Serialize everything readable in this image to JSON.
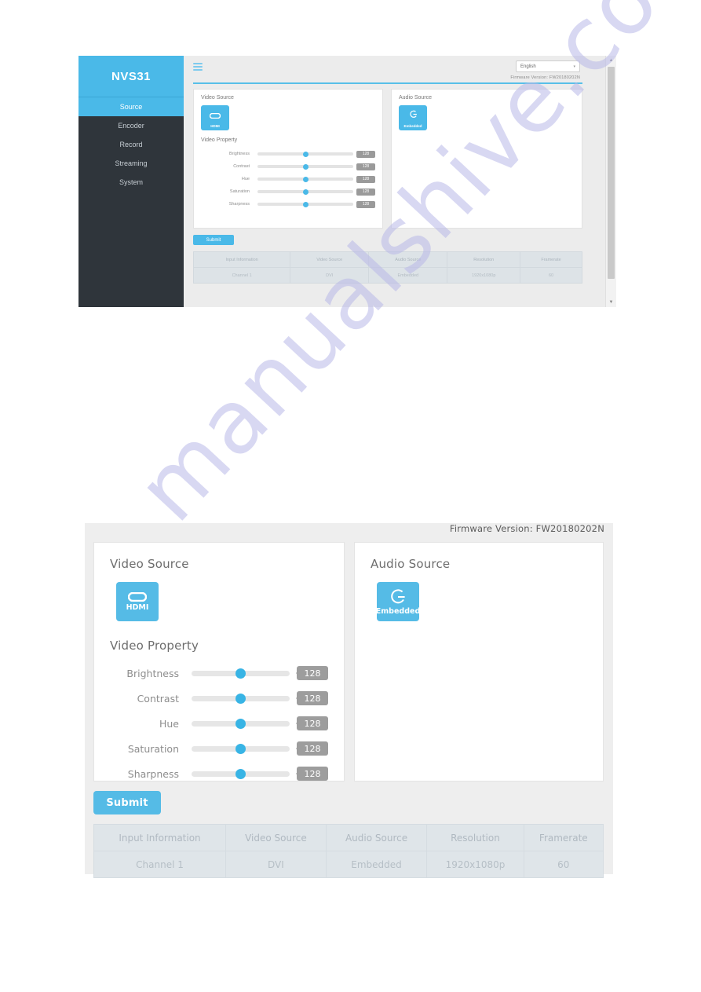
{
  "watermark": {
    "text": "manualshive.com"
  },
  "screenshot_top": {
    "logo": "NVS31",
    "sidebar_items": [
      {
        "label": "Source",
        "active": true
      },
      {
        "label": "Encoder",
        "active": false
      },
      {
        "label": "Record",
        "active": false
      },
      {
        "label": "Streaming",
        "active": false
      },
      {
        "label": "System",
        "active": false
      }
    ],
    "language_select": {
      "value": "English",
      "caret": "▾"
    },
    "firmware": "Firmware Version: FW20180202N",
    "menu_icon": "hamburger-menu-icon",
    "video_source": {
      "heading": "Video Source",
      "tile_label": "HDMI",
      "tile_icon": "hdmi-port-icon"
    },
    "audio_source": {
      "heading": "Audio Source",
      "tile_label": "Embedded",
      "tile_icon": "embedded-audio-icon"
    },
    "video_property": {
      "heading": "Video Property",
      "sliders": [
        {
          "label": "Brightness",
          "value": "128"
        },
        {
          "label": "Contrast",
          "value": "128"
        },
        {
          "label": "Hue",
          "value": "128"
        },
        {
          "label": "Saturation",
          "value": "128"
        },
        {
          "label": "Sharpness",
          "value": "128"
        }
      ]
    },
    "submit_label": "Submit",
    "table": {
      "headers": [
        "Input Information",
        "Video Source",
        "Audio Source",
        "Resolution",
        "Framerate"
      ],
      "rows": [
        [
          "Channel 1",
          "DVI",
          "Embedded",
          "1920x1080p",
          "60"
        ]
      ]
    },
    "scrollbar": {
      "up": "▲",
      "down": "▼"
    }
  },
  "screenshot_bottom": {
    "firmware": "Firmware Version: FW20180202N",
    "video_source": {
      "heading": "Video Source",
      "tile_label": "HDMI",
      "tile_icon": "hdmi-port-icon"
    },
    "audio_source": {
      "heading": "Audio Source",
      "tile_label": "Embedded",
      "tile_icon": "embedded-audio-icon"
    },
    "video_property": {
      "heading": "Video Property",
      "sliders": [
        {
          "label": "Brightness",
          "value": "128"
        },
        {
          "label": "Contrast",
          "value": "128"
        },
        {
          "label": "Hue",
          "value": "128"
        },
        {
          "label": "Saturation",
          "value": "128"
        },
        {
          "label": "Sharpness",
          "value": "128"
        }
      ]
    },
    "submit_label": "Submit",
    "table": {
      "headers": [
        "Input Information",
        "Video Source",
        "Audio Source",
        "Resolution",
        "Framerate"
      ],
      "rows": [
        [
          "Channel 1",
          "DVI",
          "Embedded",
          "1920x1080p",
          "60"
        ]
      ]
    }
  },
  "colors": {
    "accent_blue": "#4ab9e8",
    "sidebar_dark": "#2f353b",
    "panel_bg": "#ececec",
    "value_badge": "#9a9a9a"
  }
}
